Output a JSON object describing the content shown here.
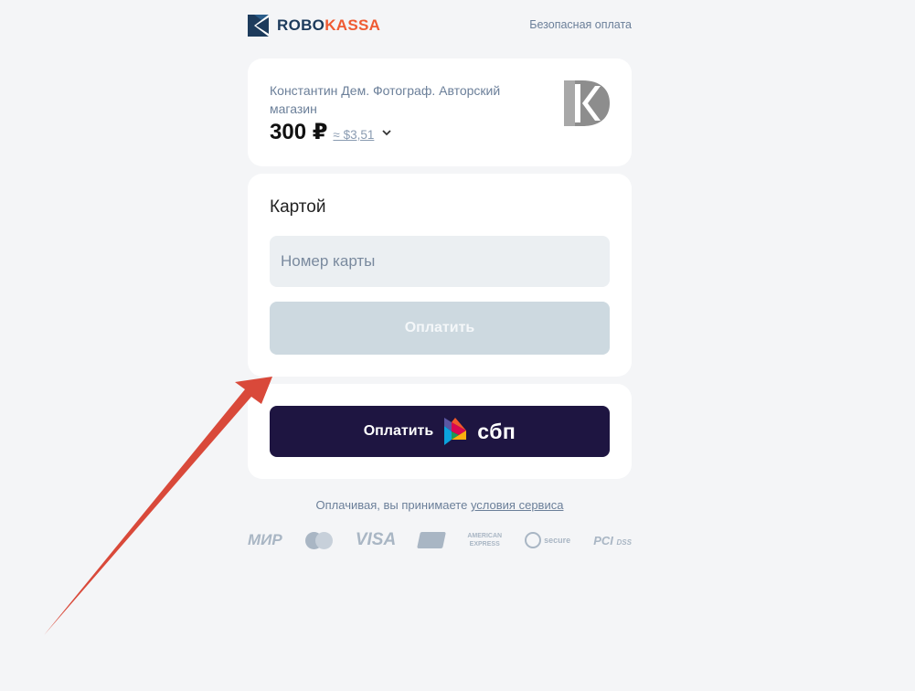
{
  "header": {
    "brand_part1": "ROBO",
    "brand_part2": "KASSA",
    "secure_link": "Безопасная оплата",
    "colors": {
      "brand_dark": "#1d3b5c",
      "brand_accent": "#ef5b33"
    }
  },
  "merchant": {
    "name": "Константин Дем. Фотограф. Авторский магазин",
    "amount": "300 ₽",
    "amount_usd": "≈ $3,51",
    "logo_icon": "merchant-logo-icon",
    "chevron_icon": "chevron-down-icon"
  },
  "card_form": {
    "title": "Картой",
    "card_number_placeholder": "Номер карты",
    "pay_label": "Оплатить"
  },
  "sbp": {
    "pay_label": "Оплатить",
    "brand": "сбп",
    "colors": {
      "button_bg": "#1e1541"
    }
  },
  "terms": {
    "prefix": "Оплачивая, вы принимаете ",
    "link": "условия сервиса"
  },
  "payment_logos": {
    "mir": "МИР",
    "mastercard_icon": "mastercard-icon",
    "visa": "VISA",
    "unionpay_icon": "unionpay-icon",
    "amex_line1": "AMERICAN",
    "amex_line2": "EXPRESS",
    "secure": "secure",
    "pci": "PCI",
    "dss": "DSS"
  },
  "annotation": {
    "arrow_color": "#d9493a",
    "arrow_icon": "red-arrow-icon"
  }
}
